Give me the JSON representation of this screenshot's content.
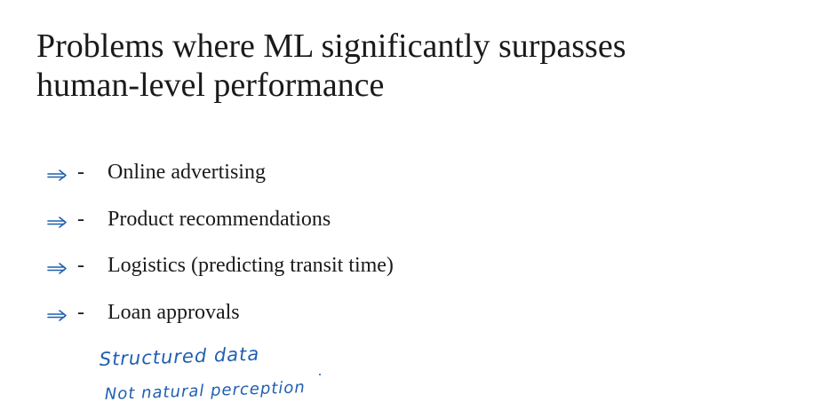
{
  "slide": {
    "title_lines": [
      "Problems where ML significantly surpasses",
      "human-level performance"
    ],
    "bullets": [
      {
        "marker": "-",
        "text": "Online advertising"
      },
      {
        "marker": "-",
        "text": "Product recommendations"
      },
      {
        "marker": "-",
        "text": "Logistics (predicting transit time)"
      },
      {
        "marker": "-",
        "text": "Loan approvals"
      }
    ],
    "annotation_icon": "hand-drawn-arrow-icon",
    "handwritten_notes": [
      "Structured data",
      "Not natural perception"
    ],
    "colors": {
      "text": "#1a1a1a",
      "ink": "#1f5fb0",
      "background": "#ffffff"
    }
  }
}
